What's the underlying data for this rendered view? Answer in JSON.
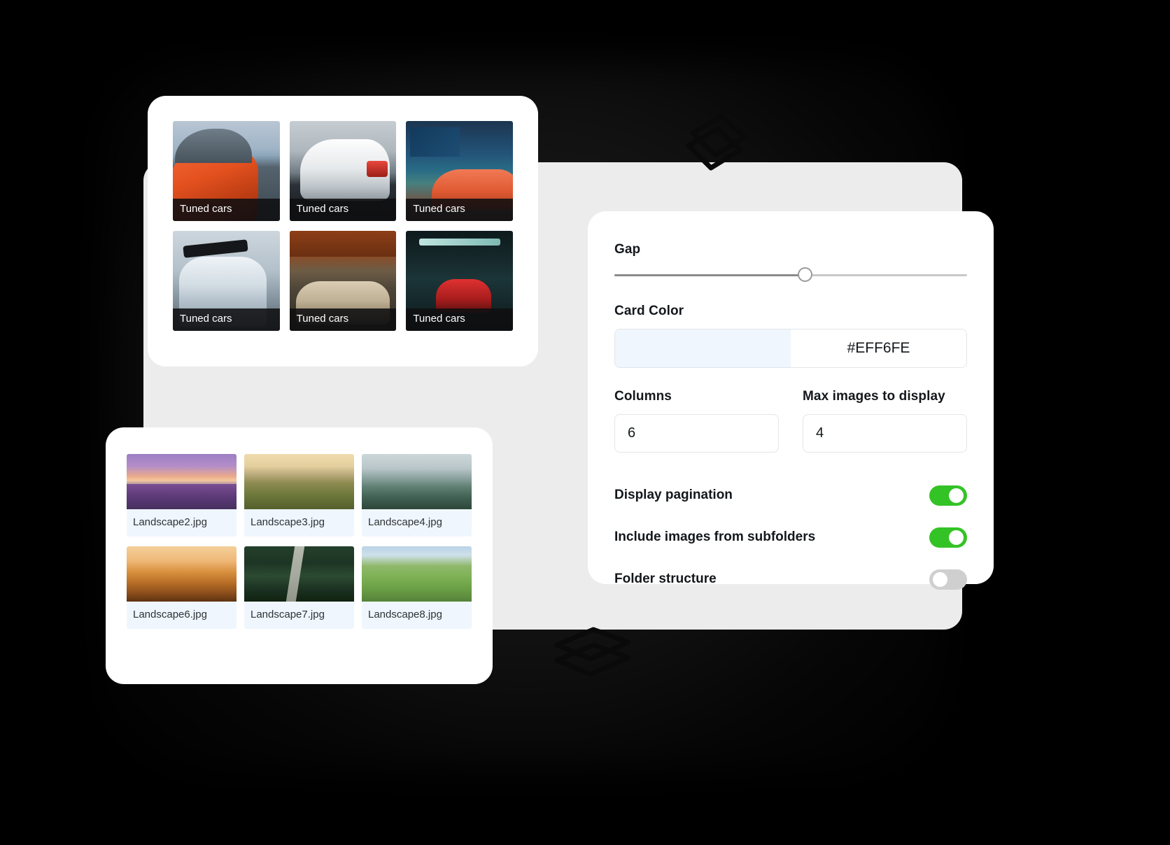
{
  "cars_gallery": {
    "name": "tuned-cars-gallery",
    "tiles": [
      {
        "caption": "Tuned cars",
        "art": "carA"
      },
      {
        "caption": "Tuned cars",
        "art": "carB"
      },
      {
        "caption": "Tuned cars",
        "art": "carC"
      },
      {
        "caption": "Tuned cars",
        "art": "carD"
      },
      {
        "caption": "Tuned cars",
        "art": "carE"
      },
      {
        "caption": "Tuned cars",
        "art": "carF"
      }
    ]
  },
  "landscape_gallery": {
    "name": "landscape-files-gallery",
    "tiles": [
      {
        "caption": "Landscape2.jpg",
        "art": "landA"
      },
      {
        "caption": "Landscape3.jpg",
        "art": "landB"
      },
      {
        "caption": "Landscape4.jpg",
        "art": "landC"
      },
      {
        "caption": "Landscape6.jpg",
        "art": "landD"
      },
      {
        "caption": "Landscape7.jpg",
        "art": "landE"
      },
      {
        "caption": "Landscape8.jpg",
        "art": "landF"
      }
    ]
  },
  "settings": {
    "gap": {
      "label": "Gap",
      "value_percent": 54
    },
    "card_color": {
      "label": "Card Color",
      "hex": "#EFF6FE",
      "swatch_color": "#EFF6FE"
    },
    "columns": {
      "label": "Columns",
      "value": "6"
    },
    "max_images": {
      "label": "Max images to display",
      "value": "4"
    },
    "toggles": [
      {
        "label": "Display pagination",
        "state": "on"
      },
      {
        "label": "Include images from subfolders",
        "state": "on"
      },
      {
        "label": "Folder structure",
        "state": "off"
      }
    ],
    "accent_on_color": "#34C326",
    "accent_off_color": "#CFCFCF"
  }
}
